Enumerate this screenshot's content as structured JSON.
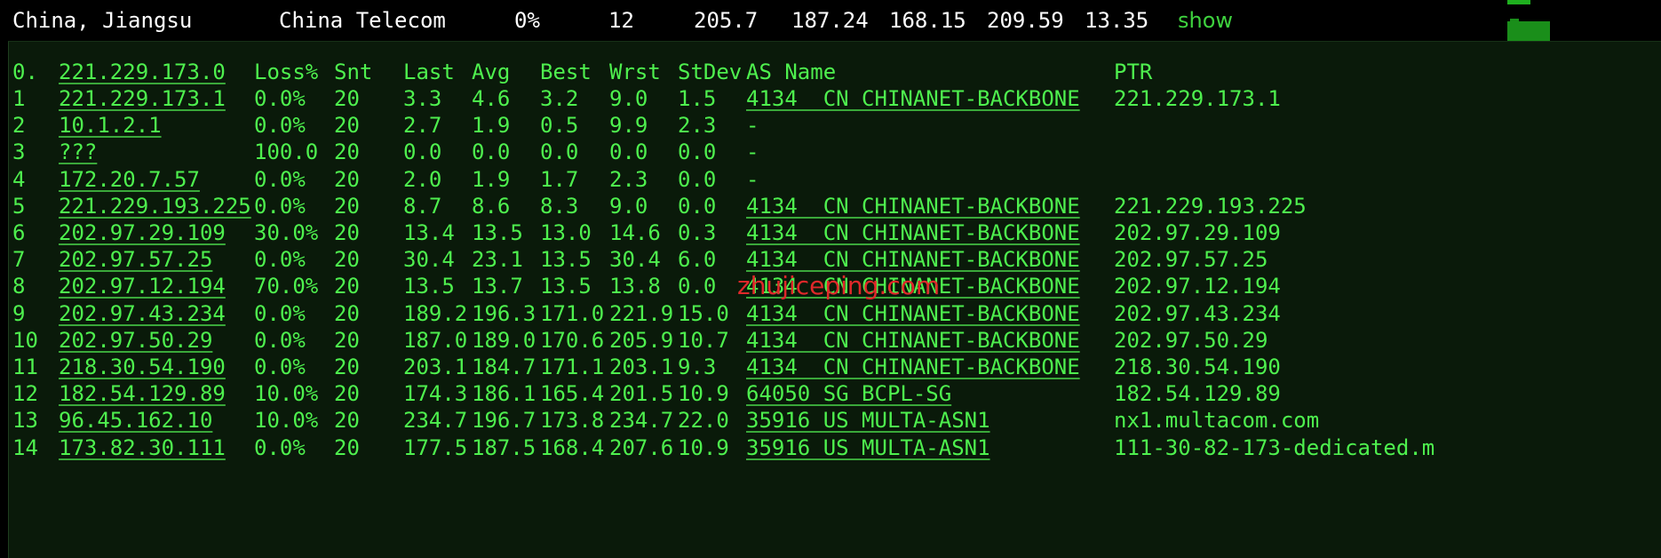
{
  "summary": {
    "location": "China, Jiangsu",
    "isp": "China Telecom",
    "loss": "0%",
    "sent": "12",
    "last": "205.7",
    "avg": "187.24",
    "best": "168.15",
    "worst": "209.59",
    "stdev": "13.35",
    "show_label": "show"
  },
  "table": {
    "header": {
      "idx": "0.",
      "host": "221.229.173.0",
      "loss": "Loss%",
      "snt": "Snt",
      "last": "Last",
      "avg": "Avg",
      "best": "Best",
      "wrst": "Wrst",
      "stdev": "StDev",
      "as": "AS Name",
      "ptr": "PTR"
    },
    "rows": [
      {
        "idx": "1",
        "host": "221.229.173.1",
        "loss": "0.0%",
        "snt": "20",
        "last": "3.3",
        "avg": "4.6",
        "best": "3.2",
        "wrst": "9.0",
        "stdev": "1.5",
        "as": "4134  CN CHINANET-BACKBONE",
        "ptr": "221.229.173.1"
      },
      {
        "idx": "2",
        "host": "10.1.2.1",
        "loss": "0.0%",
        "snt": "20",
        "last": "2.7",
        "avg": "1.9",
        "best": "0.5",
        "wrst": "9.9",
        "stdev": "2.3",
        "as": "-",
        "ptr": ""
      },
      {
        "idx": "3",
        "host": "???",
        "loss": "100.0",
        "snt": "20",
        "last": "0.0",
        "avg": "0.0",
        "best": "0.0",
        "wrst": "0.0",
        "stdev": "0.0",
        "as": "-",
        "ptr": ""
      },
      {
        "idx": "4",
        "host": "172.20.7.57",
        "loss": "0.0%",
        "snt": "20",
        "last": "2.0",
        "avg": "1.9",
        "best": "1.7",
        "wrst": "2.3",
        "stdev": "0.0",
        "as": "-",
        "ptr": ""
      },
      {
        "idx": "5",
        "host": "221.229.193.225",
        "loss": "0.0%",
        "snt": "20",
        "last": "8.7",
        "avg": "8.6",
        "best": "8.3",
        "wrst": "9.0",
        "stdev": "0.0",
        "as": "4134  CN CHINANET-BACKBONE",
        "ptr": "221.229.193.225"
      },
      {
        "idx": "6",
        "host": "202.97.29.109",
        "loss": "30.0%",
        "snt": "20",
        "last": "13.4",
        "avg": "13.5",
        "best": "13.0",
        "wrst": "14.6",
        "stdev": "0.3",
        "as": "4134  CN CHINANET-BACKBONE",
        "ptr": "202.97.29.109"
      },
      {
        "idx": "7",
        "host": "202.97.57.25",
        "loss": "0.0%",
        "snt": "20",
        "last": "30.4",
        "avg": "23.1",
        "best": "13.5",
        "wrst": "30.4",
        "stdev": "6.0",
        "as": "4134  CN CHINANET-BACKBONE",
        "ptr": "202.97.57.25"
      },
      {
        "idx": "8",
        "host": "202.97.12.194",
        "loss": "70.0%",
        "snt": "20",
        "last": "13.5",
        "avg": "13.7",
        "best": "13.5",
        "wrst": "13.8",
        "stdev": "0.0",
        "as": "4134  CN CHINANET-BACKBONE",
        "ptr": "202.97.12.194"
      },
      {
        "idx": "9",
        "host": "202.97.43.234",
        "loss": "0.0%",
        "snt": "20",
        "last": "189.2",
        "avg": "196.3",
        "best": "171.0",
        "wrst": "221.9",
        "stdev": "15.0",
        "as": "4134  CN CHINANET-BACKBONE",
        "ptr": "202.97.43.234"
      },
      {
        "idx": "10",
        "host": "202.97.50.29",
        "loss": "0.0%",
        "snt": "20",
        "last": "187.0",
        "avg": "189.0",
        "best": "170.6",
        "wrst": "205.9",
        "stdev": "10.7",
        "as": "4134  CN CHINANET-BACKBONE",
        "ptr": "202.97.50.29"
      },
      {
        "idx": "11",
        "host": "218.30.54.190",
        "loss": "0.0%",
        "snt": "20",
        "last": "203.1",
        "avg": "184.7",
        "best": "171.1",
        "wrst": "203.1",
        "stdev": "9.3",
        "as": "4134  CN CHINANET-BACKBONE",
        "ptr": "218.30.54.190"
      },
      {
        "idx": "12",
        "host": "182.54.129.89",
        "loss": "10.0%",
        "snt": "20",
        "last": "174.3",
        "avg": "186.1",
        "best": "165.4",
        "wrst": "201.5",
        "stdev": "10.9",
        "as": "64050 SG BCPL-SG",
        "ptr": "182.54.129.89"
      },
      {
        "idx": "13",
        "host": "96.45.162.10",
        "loss": "10.0%",
        "snt": "20",
        "last": "234.7",
        "avg": "196.7",
        "best": "173.8",
        "wrst": "234.7",
        "stdev": "22.0",
        "as": "35916 US MULTA-ASN1",
        "ptr": "nx1.multacom.com"
      },
      {
        "idx": "14",
        "host": "173.82.30.111",
        "loss": "0.0%",
        "snt": "20",
        "last": "177.5",
        "avg": "187.5",
        "best": "168.4",
        "wrst": "207.6",
        "stdev": "10.9",
        "as": "35916 US MULTA-ASN1",
        "ptr": "111-30-82-173-dedicated.m"
      }
    ]
  },
  "watermark": "zhujiceping.com",
  "colors": {
    "terminal_bg": "#0a1a0a",
    "terminal_text": "#4ef04e",
    "watermark": "#e0282a",
    "show_link": "#3ed23e"
  }
}
